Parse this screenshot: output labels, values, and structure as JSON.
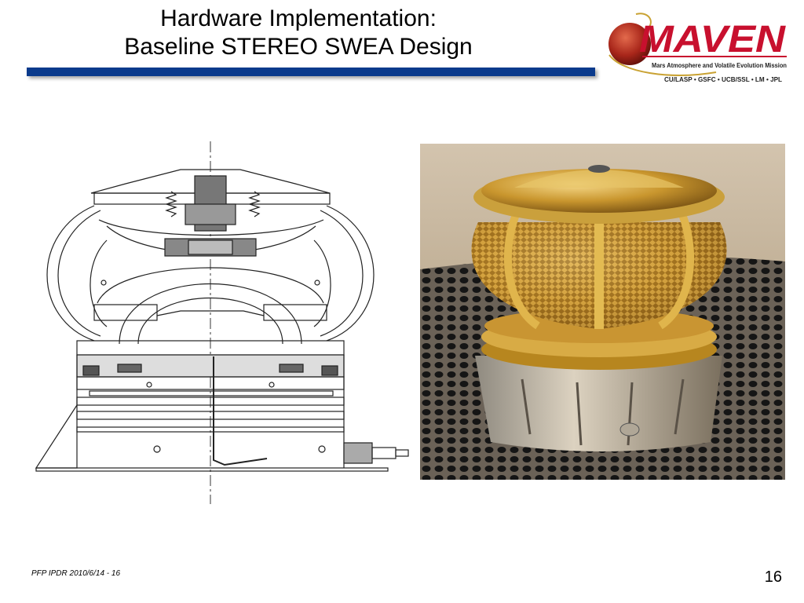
{
  "slide": {
    "title_line1": "Hardware Implementation:",
    "title_line2": "Baseline STEREO SWEA Design",
    "footer": "PFP IPDR 2010/6/14 - 16",
    "page_number": "16"
  },
  "logo": {
    "name": "MAVEN",
    "subtitle": "Mars Atmosphere and Volatile Evolution Mission",
    "partners": "CU/LASP • GSFC • UCB/SSL • LM • JPL"
  },
  "colors": {
    "title_bar": "#0a3a8c",
    "logo_red": "#c8102e",
    "gold": "#c9a233"
  }
}
